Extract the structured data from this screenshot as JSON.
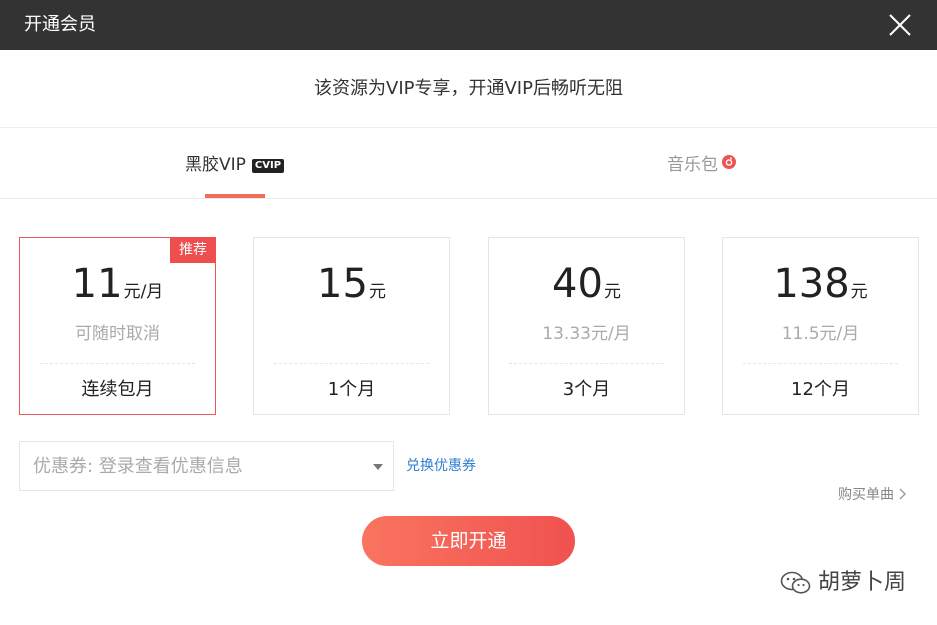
{
  "window": {
    "title": "开通会员"
  },
  "subtitle": "该资源为VIP专享，开通VIP后畅听无阻",
  "tabs": [
    {
      "label": "黑胶VIP",
      "badge": "CVIP",
      "active": true
    },
    {
      "label": "音乐包",
      "active": false
    }
  ],
  "plans": [
    {
      "price": "11",
      "unit": "元/月",
      "sub": "可随时取消",
      "period": "连续包月",
      "badge": "推荐",
      "selected": true
    },
    {
      "price": "15",
      "unit": "元",
      "sub": "",
      "period": "1个月",
      "selected": false
    },
    {
      "price": "40",
      "unit": "元",
      "sub": "13.33元/月",
      "period": "3个月",
      "selected": false
    },
    {
      "price": "138",
      "unit": "元",
      "sub": "11.5元/月",
      "period": "12个月",
      "selected": false
    }
  ],
  "coupon": {
    "placeholder": "优惠券: 登录查看优惠信息",
    "redeem_label": "兑换优惠券"
  },
  "buy_single_label": "购买单曲",
  "open_button_label": "立即开通",
  "watermark": "胡萝卜周",
  "colors": {
    "titlebar": "#333333",
    "accent": "#f26b5b",
    "badge": "#ee4e4e",
    "link": "#2f7fcf"
  }
}
